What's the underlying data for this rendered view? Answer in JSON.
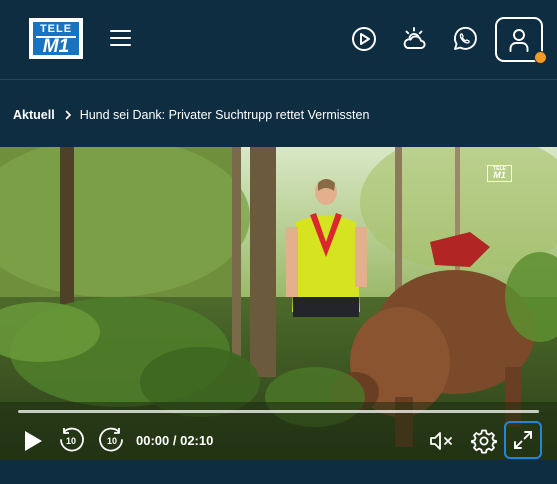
{
  "header": {
    "logo": {
      "top": "TELE",
      "bottom": "M1"
    },
    "icons": [
      "menu-icon",
      "play-circle-icon",
      "weather-icon",
      "whatsapp-icon",
      "user-icon"
    ],
    "notification_color": "#f59a23"
  },
  "breadcrumb": {
    "home": "Aktuell",
    "current": "Hund sei Dank: Privater Suchtrupp rettet Vermissten"
  },
  "player": {
    "watermark": {
      "top": "TELE",
      "bottom": "M1"
    },
    "current_time": "00:00",
    "duration": "02:10",
    "time_display": "00:00 / 02:10",
    "progress_fraction": 0,
    "skip_back_label": "10",
    "skip_forward_label": "10",
    "muted": true,
    "accent_color": "#1e86e0"
  },
  "colors": {
    "background": "#0f2d41"
  }
}
